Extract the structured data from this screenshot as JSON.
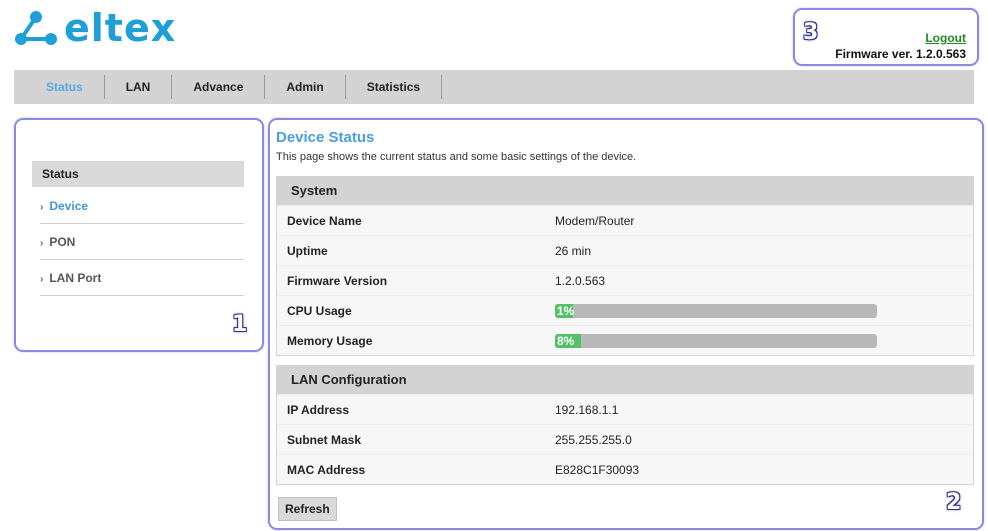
{
  "brand": {
    "logo_text": "ELTEX",
    "color": "#1f9fd8"
  },
  "header": {
    "logout_label": "Logout",
    "firmware_label": "Firmware ver. 1.2.0.563"
  },
  "nav": {
    "items": [
      "Status",
      "LAN",
      "Advance",
      "Admin",
      "Statistics"
    ],
    "active": "Status"
  },
  "sidebar": {
    "title": "Status",
    "items": [
      {
        "label": "Device"
      },
      {
        "label": "PON"
      },
      {
        "label": "LAN Port"
      }
    ]
  },
  "main": {
    "title": "Device Status",
    "description": "This page shows the current status and some basic settings of the device.",
    "system": {
      "heading": "System",
      "device_name_label": "Device Name",
      "device_name": "Modem/Router",
      "uptime_label": "Uptime",
      "uptime": "26 min",
      "firmware_label": "Firmware Version",
      "firmware": "1.2.0.563",
      "cpu_label": "CPU Usage",
      "cpu_text": "1%",
      "cpu_percent": 1,
      "memory_label": "Memory Usage",
      "memory_text": "8%",
      "memory_percent": 8
    },
    "lan": {
      "heading": "LAN Configuration",
      "ip_label": "IP Address",
      "ip": "192.168.1.1",
      "mask_label": "Subnet Mask",
      "mask": "255.255.255.0",
      "mac_label": "MAC Address",
      "mac": "E828C1F30093"
    },
    "refresh_label": "Refresh"
  },
  "callouts": {
    "sidebar": "1",
    "main": "2",
    "header": "3"
  }
}
